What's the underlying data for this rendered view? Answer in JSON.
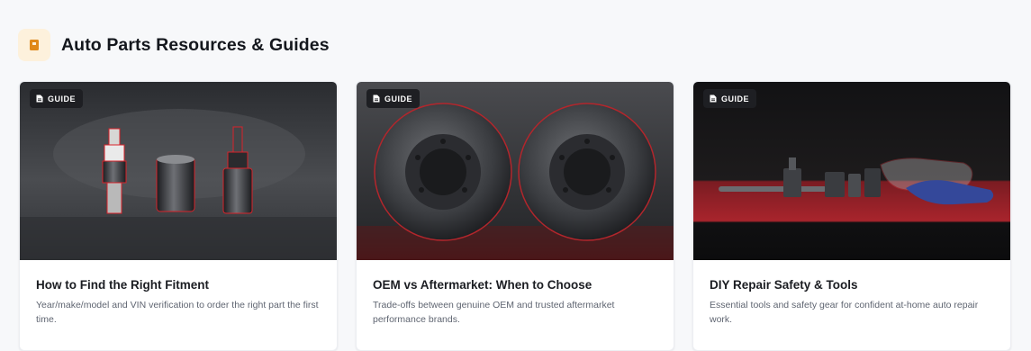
{
  "section": {
    "title": "Auto Parts Resources & Guides",
    "icon": "book-icon",
    "accent_color": "#e0891a"
  },
  "cards": [
    {
      "badge": "GUIDE",
      "title": "How to Find the Right Fitment",
      "description": "Year/make/model and VIN verification to order the right part the first time.",
      "image": "spark-plug-and-socket-photo"
    },
    {
      "badge": "GUIDE",
      "title": "OEM vs Aftermarket: When to Choose",
      "description": "Trade-offs between genuine OEM and trusted aftermarket performance brands.",
      "image": "brake-rotors-photo"
    },
    {
      "badge": "GUIDE",
      "title": "DIY Repair Safety & Tools",
      "description": "Essential tools and safety gear for confident at-home auto repair work.",
      "image": "tools-gloves-goggles-photo"
    }
  ]
}
